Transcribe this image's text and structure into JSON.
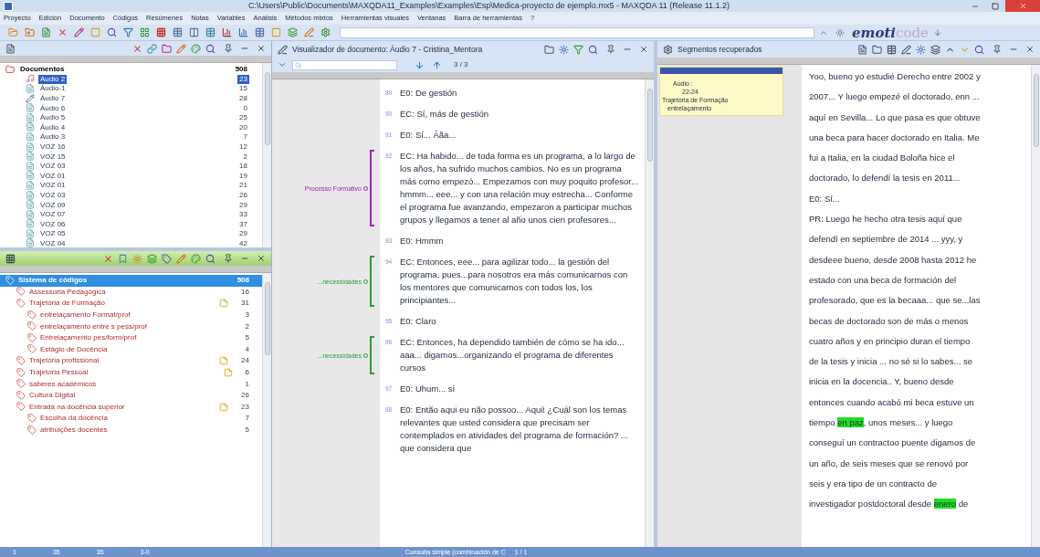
{
  "window": {
    "title": "C:\\Users\\Public\\Documents\\MAXQDA11_Examples\\Examples\\Esp\\Medica-proyecto de ejemplo.mx5 - MAXQDA 11  (Release 11.1.2)"
  },
  "menu": [
    "Proyecto",
    "Edición",
    "Documento",
    "Códigos",
    "Resúmenes",
    "Notas",
    "Variables",
    "Análisis",
    "Métodos mixtos",
    "Herramientas visuales",
    "Ventanas",
    "Barra de herramientas",
    "?"
  ],
  "toolbar": {
    "logo": {
      "main": "emoti",
      "accent": "code"
    }
  },
  "documents": {
    "root": {
      "label": "Documentos",
      "count": "508",
      "selected": false,
      "children": [
        {
          "label": "Audio 2",
          "count": "23",
          "selected": true,
          "kind": "audio"
        },
        {
          "label": "Áudio-1",
          "count": "15",
          "selected": false,
          "kind": "text"
        },
        {
          "label": "Áudio 7",
          "count": "28",
          "selected": false,
          "kind": "edited"
        },
        {
          "label": "Áudio 6",
          "count": "0",
          "selected": false,
          "kind": "text"
        },
        {
          "label": "Áudio 5",
          "count": "25",
          "selected": false,
          "kind": "text"
        },
        {
          "label": "Áudio 4",
          "count": "20",
          "selected": false,
          "kind": "text"
        },
        {
          "label": "Áudio 3",
          "count": "7",
          "selected": false,
          "kind": "text"
        },
        {
          "label": "VOZ 16",
          "count": "12",
          "selected": false,
          "kind": "text"
        },
        {
          "label": "VOZ 15",
          "count": "2",
          "selected": false,
          "kind": "text"
        },
        {
          "label": "VOZ 03",
          "count": "18",
          "selected": false,
          "kind": "text"
        },
        {
          "label": "VOZ 01",
          "count": "19",
          "selected": false,
          "kind": "text"
        },
        {
          "label": "VOZ 01",
          "count": "21",
          "selected": false,
          "kind": "text"
        },
        {
          "label": "VOZ 03",
          "count": "26",
          "selected": false,
          "kind": "text"
        },
        {
          "label": "VOZ 09",
          "count": "29",
          "selected": false,
          "kind": "text"
        },
        {
          "label": "VOZ 07",
          "count": "33",
          "selected": false,
          "kind": "text"
        },
        {
          "label": "VOZ 06",
          "count": "37",
          "selected": false,
          "kind": "text"
        },
        {
          "label": "VOZ 05",
          "count": "29",
          "selected": false,
          "kind": "text"
        },
        {
          "label": "VOZ 04",
          "count": "42",
          "selected": false,
          "kind": "text"
        }
      ]
    }
  },
  "codes": {
    "root": {
      "label": "Sistema de códigos",
      "count": "508",
      "selected": true,
      "memo": false,
      "children": [
        {
          "label": "Assessoria Pedagógica",
          "count": "16",
          "selected": false,
          "memo": false
        },
        {
          "label": "Trajetória de Formação",
          "count": "31",
          "selected": false,
          "memo": true,
          "children": [
            {
              "label": "entrelaçamento Format/prof",
              "count": "3",
              "selected": false,
              "memo": false
            },
            {
              "label": "entrelaçamento entre s pess/prof",
              "count": "2",
              "selected": false,
              "memo": false
            },
            {
              "label": "Entrelaçamento pes/form/prof",
              "count": "5",
              "selected": false,
              "memo": false
            },
            {
              "label": "Estágio de Docência",
              "count": "4",
              "selected": false,
              "memo": false
            }
          ]
        },
        {
          "label": "Trajetória profissional",
          "count": "24",
          "selected": false,
          "memo": true
        },
        {
          "label": "Trajetória Pessoal",
          "count": "6",
          "selected": false,
          "memo": true
        },
        {
          "label": "saberes académicos",
          "count": "1",
          "selected": false,
          "memo": false
        },
        {
          "label": "Cultura Digital",
          "count": "26",
          "selected": false,
          "memo": false
        },
        {
          "label": "Entrada na docência superior",
          "count": "23",
          "selected": false,
          "memo": true,
          "children": [
            {
              "label": "Escolha da docência",
              "count": "7",
              "selected": false,
              "memo": false
            },
            {
              "label": "atribuições docentes",
              "count": "5",
              "selected": false,
              "memo": false
            }
          ]
        }
      ]
    }
  },
  "viewer": {
    "title": "Visualizador de documento: Áudio 7 - Cristina_Mentora",
    "hits": "3 / 3",
    "paragraphs": [
      {
        "number": "89",
        "text": "E0: De gestión"
      },
      {
        "number": "90",
        "text": "EC: Sí, más de gestión"
      },
      {
        "number": "91",
        "text": "E0: Sí... Ããa..."
      },
      {
        "number": "92",
        "text": "EC: Ha habido... de toda forma es un programa, a lo largo de los años, ha sufrido muchos cambios. No es un programa más como empezó... Empezamos con muy poquito profesor... hmmm... eee... y con una relación muy estrecha... Conforme el programa fue avanzando, empezaron a participar muchos grupos y llegamos a tener al año unos cien profesores...",
        "code": {
          "label": "Processo Formativo",
          "color": "#a020c0"
        }
      },
      {
        "number": "93",
        "text": "E0: Hmmm"
      },
      {
        "number": "94",
        "text": "EC: Entonces, eee... para agilizar todo... la gestión del programa, pues...para nosotros era más comunicarnos con los mentores que comunicarnos con todos los, los principiantes...",
        "code": {
          "label": "...necessidades",
          "color": "#2e9a3a"
        }
      },
      {
        "number": "95",
        "text": "E0: Claro"
      },
      {
        "number": "96",
        "text": "EC: Entonces, ha dependido también de cómo se ha ido... aaa... digamos...organizando el programa de diferentes cursos",
        "code": {
          "label": "...necessidades",
          "color": "#2e9a3a"
        }
      },
      {
        "number": "97",
        "text": "E0: Uhum... sí"
      },
      {
        "number": "98",
        "text": "E0: Então aqui eu não possoo... Aqui! ¿Cuál son los temas relevantes que usted considera que precisam ser contemplados en atividades del programa de formación? ... que considera que"
      }
    ]
  },
  "segments": {
    "title": "Segmentos recuperados",
    "note": {
      "document": "Audio :",
      "range": "22-24",
      "code": "Trajetória de Formação",
      "subcode": "entrelaçamento"
    },
    "lines": [
      [
        {
          "text": "Yoo, bueno yo estudié Derecho entre 2002 y",
          "highlighted": false
        }
      ],
      [
        {
          "text": "2007... Y luego empezé el doctorado, enn ...",
          "highlighted": false
        }
      ],
      [
        {
          "text": "aquí en Sevilla... Lo que pasa es que obtuve",
          "highlighted": false
        }
      ],
      [
        {
          "text": "una beca para hacer doctorado en Italia. Me",
          "highlighted": false
        }
      ],
      [
        {
          "text": "fui a Italia, en la ciudad Boloña hice el",
          "highlighted": false
        }
      ],
      [
        {
          "text": "doctorado, lo defendí la tesis en 2011...",
          "highlighted": false
        }
      ],
      [
        {
          "text": "E0: Sí...",
          "highlighted": false
        }
      ],
      [
        {
          "text": "PR: Luego he hecho otra tesis aquí que",
          "highlighted": false
        }
      ],
      [
        {
          "text": "defendí en septiembre de 2014 ... yyy, y",
          "highlighted": false
        }
      ],
      [
        {
          "text": "desdeee bueno, desde 2008 hasta 2012 he",
          "highlighted": false
        }
      ],
      [
        {
          "text": "estado con una beca de formación del",
          "highlighted": false
        }
      ],
      [
        {
          "text": "profesorado, que es la becaaa... que se...las",
          "highlighted": false
        }
      ],
      [
        {
          "text": "becas de doctorado son de más o menos",
          "highlighted": false
        }
      ],
      [
        {
          "text": "cuatro años y en principio duran el tiempo",
          "highlighted": false
        }
      ],
      [
        {
          "text": "de la tesis y inicia ... no sé si lo sabes... se",
          "highlighted": false
        }
      ],
      [
        {
          "text": "inicia en la docencia.. Y, bueno desde",
          "highlighted": false
        }
      ],
      [
        {
          "text": "entonces cuando acabó mi beca estuve un",
          "highlighted": false
        }
      ],
      [
        {
          "text": "tiempo ",
          "highlighted": false
        },
        {
          "text": "en paz",
          "highlighted": true
        },
        {
          "text": ", unos meses... y luego",
          "highlighted": false
        }
      ],
      [
        {
          "text": "conseguí un contractoo puente digamos de",
          "highlighted": false
        }
      ],
      [
        {
          "text": "un año, de seis meses que se renovó por",
          "highlighted": false
        }
      ],
      [
        {
          "text": "seis y era tipo de un contracto de",
          "highlighted": false
        }
      ],
      [
        {
          "text": "investigador postdoctoral desde ",
          "highlighted": false
        },
        {
          "text": "enero",
          "highlighted": true
        },
        {
          "text": " de",
          "highlighted": false
        }
      ]
    ]
  },
  "status_bar": {
    "items": [
      "1",
      "35",
      "35",
      "3-0"
    ],
    "query": "Consulta simple (combinación de C",
    "pages": "1 / 1"
  }
}
